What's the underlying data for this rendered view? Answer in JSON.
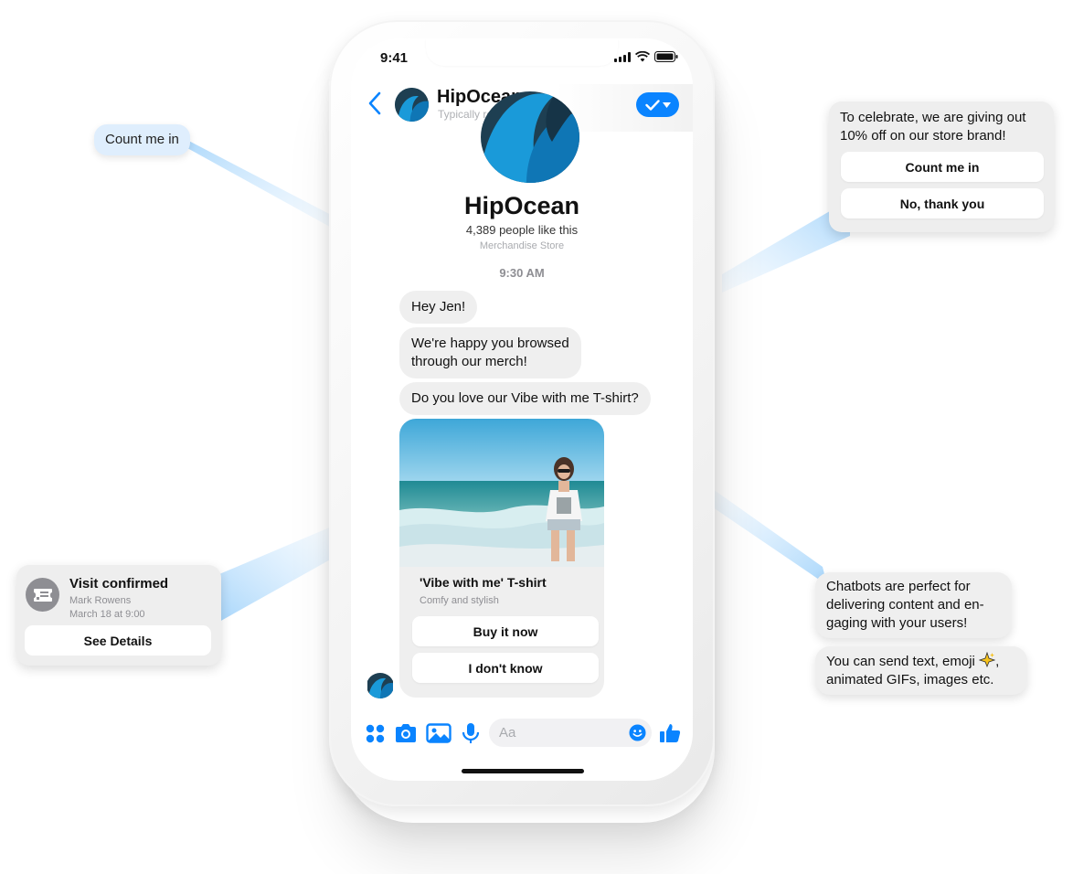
{
  "status_bar": {
    "time": "9:41"
  },
  "header": {
    "title": "HipOcean",
    "subtitle": "Typically replies instantly",
    "back_icon": "chevron-left-icon",
    "action_icon": "check-dropdown-icon"
  },
  "profile": {
    "name": "HipOcean",
    "likes": "4,389 people like this",
    "category": "Merchandise Store"
  },
  "timestamp": "9:30 AM",
  "messages": [
    {
      "text": "Hey Jen!"
    },
    {
      "text_lines": [
        "We're happy you browsed",
        "through our merch!"
      ]
    },
    {
      "text": "Do you love our Vibe with me T-shirt?"
    }
  ],
  "product_card": {
    "title": "'Vibe with me' T-shirt",
    "subtitle": "Comfy and stylish",
    "buttons": [
      "Buy it now",
      "I don't know"
    ]
  },
  "composer": {
    "placeholder": "Aa",
    "icons": [
      "apps-icon",
      "camera-icon",
      "image-icon",
      "microphone-icon",
      "emoji-icon",
      "thumbs-up-icon"
    ]
  },
  "callouts": {
    "count_bubble": "Count me in",
    "promo": {
      "text": "To celebrate, we are giving out 10% off on our store brand!",
      "buttons": [
        "Count me in",
        "No, thank you"
      ]
    },
    "visit": {
      "title": "Visit confirmed",
      "name": "Mark Rowens",
      "date": "March 18 at 9:00",
      "button": "See Details"
    },
    "chatbots_lines": [
      "Chatbots are perfect for",
      "delivering content and en-",
      "gaging with your users!"
    ],
    "send_lines": [
      "You can send text, emoji",
      ",",
      "animated GIFs, images etc."
    ]
  },
  "colors": {
    "accent": "#0a84ff",
    "bubble": "#efefef",
    "beam": "#bfe0fb"
  }
}
